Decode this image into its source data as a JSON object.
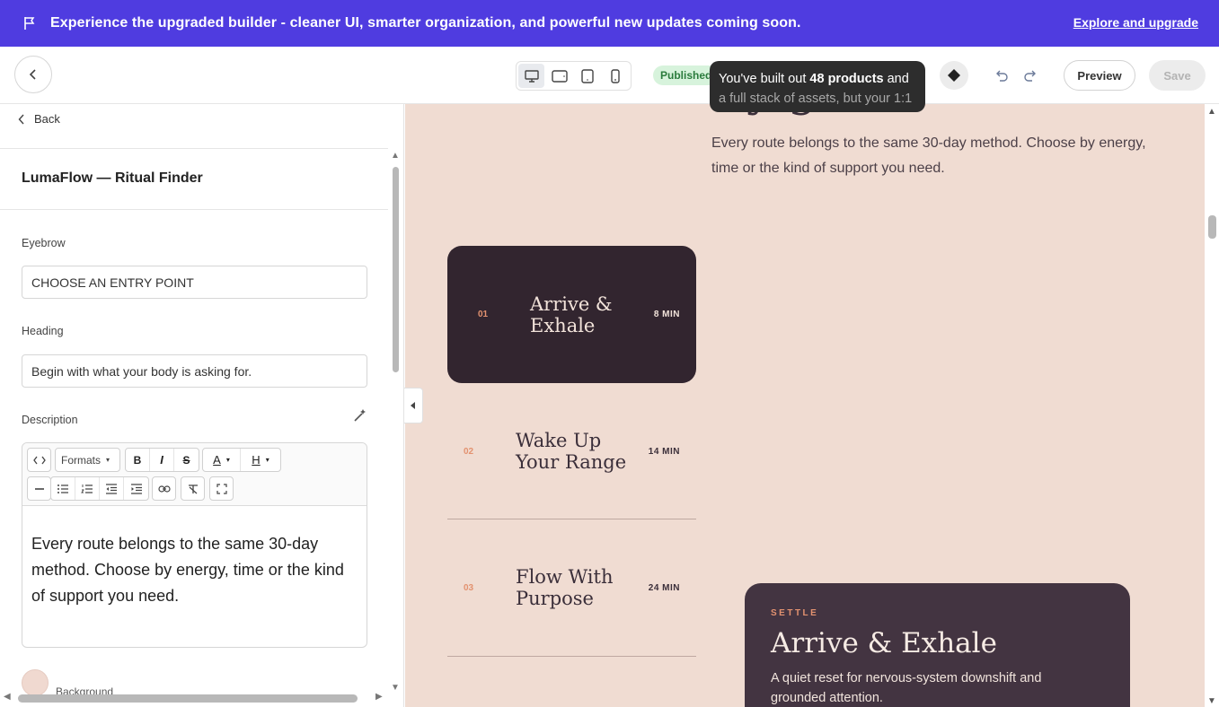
{
  "banner": {
    "message": "Experience the upgraded builder - cleaner UI, smarter organization, and powerful new updates coming soon.",
    "link": "Explore and upgrade",
    "color": "#4f3ce0"
  },
  "toolbar": {
    "devices": [
      "desktop",
      "tablet-landscape",
      "tablet-portrait",
      "mobile"
    ],
    "active_device": "desktop",
    "status": "Published",
    "tooltip_pre": "You've built out ",
    "tooltip_bold": "48 products",
    "tooltip_post": " and",
    "tooltip_line2": "a full stack of assets, but your 1:1",
    "preview_label": "Preview",
    "save_label": "Save"
  },
  "panel": {
    "back_label": "Back",
    "title": "LumaFlow — Ritual Finder",
    "eyebrow_label": "Eyebrow",
    "eyebrow_value": "CHOOSE AN ENTRY POINT",
    "heading_label": "Heading",
    "heading_value": "Begin with what your body is asking for.",
    "description_label": "Description",
    "editor": {
      "formats_label": "Formats",
      "bold": "B",
      "italic": "I",
      "strike": "S",
      "text_color": "A",
      "highlight": "H",
      "content": "Every route belongs to the same 30-day method. Choose by energy, time or the kind of support you need."
    },
    "background_label": "Background",
    "background_color": "#f0d9d0"
  },
  "canvas": {
    "description": "Every route belongs to the same 30-day method. Choose by energy, time or the kind of support you need.",
    "routes": [
      {
        "num": "01",
        "name": "Arrive & Exhale",
        "duration": "8 MIN",
        "active": true
      },
      {
        "num": "02",
        "name": "Wake Up Your Range",
        "duration": "14 MIN",
        "active": false
      },
      {
        "num": "03",
        "name": "Flow With Purpose",
        "duration": "24 MIN",
        "active": false
      }
    ],
    "detail": {
      "eyebrow": "SETTLE",
      "title": "Arrive & Exhale",
      "text": "A quiet reset for nervous-system downshift and grounded attention."
    },
    "colors": {
      "background": "#f0dcd2",
      "dark": "#32252f",
      "accent": "#e39270"
    }
  }
}
